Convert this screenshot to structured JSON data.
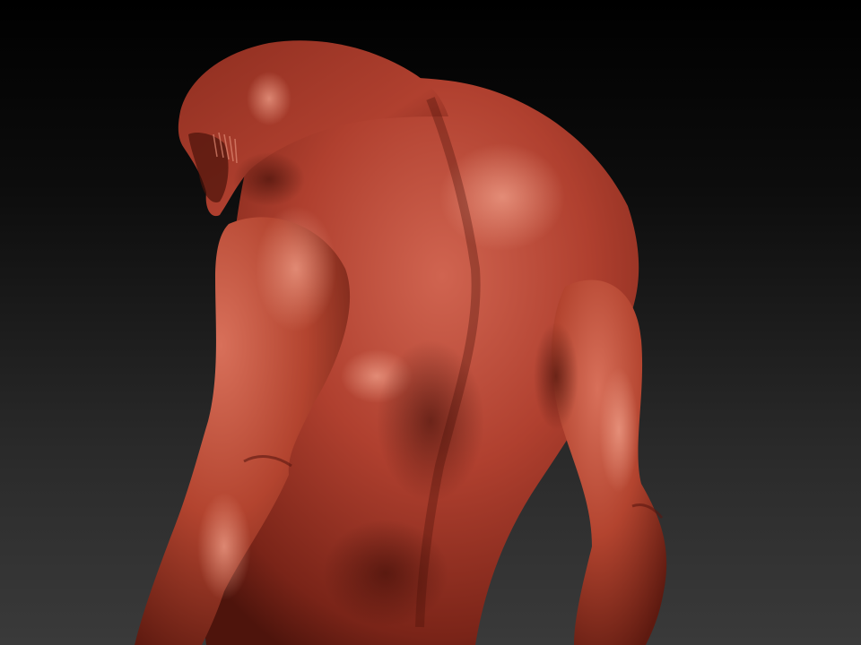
{
  "scene": {
    "subject": "sculpt-model",
    "material_color": "#b0402f",
    "highlight_color": "#e58a70",
    "shadow_color": "#5a1810",
    "background_top": "#000000",
    "background_bottom": "#3a3a3a"
  }
}
